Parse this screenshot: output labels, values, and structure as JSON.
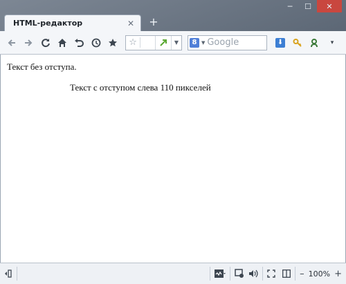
{
  "window": {
    "controls": {
      "minimize": "─",
      "maximize": "☐",
      "close": "✕"
    }
  },
  "tabs": [
    {
      "title": "HTML-редактор",
      "close": "✕"
    }
  ],
  "newtab": "+",
  "toolbar": {
    "back": "back-arrow-icon",
    "forward": "forward-arrow-icon",
    "reload": "reload-icon",
    "home": "home-icon",
    "undo": "undo-icon",
    "history": "clock-icon",
    "bookmarks": "star-icon",
    "url_value": "",
    "search_placeholder": "Google",
    "search_engine_letter": "8"
  },
  "page": {
    "text_no_indent": "Текст без отступа.",
    "text_indent": "Текст с отступом слева 110 пикселей"
  },
  "status": {
    "zoom": "100%",
    "zoom_minus": "–",
    "zoom_plus": "+"
  },
  "colors": {
    "close": "#c9473f",
    "go_arrow": "#5aa832",
    "download": "#3d7fd4",
    "key": "#d9a21c"
  }
}
